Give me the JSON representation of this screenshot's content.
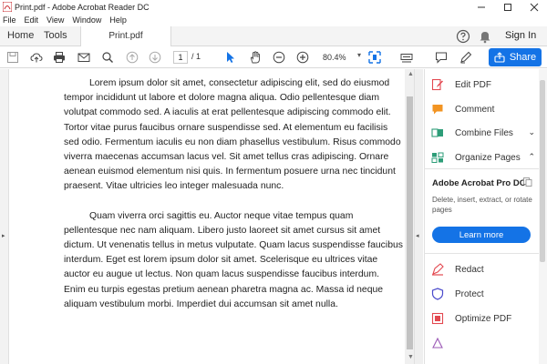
{
  "window": {
    "title": "Print.pdf - Adobe Acrobat Reader DC"
  },
  "menu": [
    "File",
    "Edit",
    "View",
    "Window",
    "Help"
  ],
  "tabs": {
    "home": "Home",
    "tools": "Tools",
    "document": "Print.pdf"
  },
  "header": {
    "signin": "Sign In"
  },
  "toolbar": {
    "page_current": "1",
    "page_total": "/ 1",
    "zoom": "80.4%",
    "share_label": "Share"
  },
  "document": {
    "paragraphs": [
      "Lorem ipsum dolor sit amet, consectetur adipiscing elit, sed do eiusmod tempor incididunt ut labore et dolore magna aliqua. Odio pellentesque diam volutpat commodo sed. A iaculis at erat pellentesque adipiscing commodo elit. Tortor vitae purus faucibus ornare suspendisse sed. At elementum eu facilisis sed odio. Fermentum iaculis eu non diam phasellus vestibulum. Risus commodo viverra maecenas accumsan lacus vel. Sit amet tellus cras adipiscing. Ornare aenean euismod elementum nisi quis. In fermentum posuere urna nec tincidunt praesent. Vitae ultricies leo integer malesuada nunc.",
      "Quam viverra orci sagittis eu. Auctor neque vitae tempus quam pellentesque nec nam aliquam. Libero justo laoreet sit amet cursus sit amet dictum. Ut venenatis tellus in metus vulputate. Quam lacus suspendisse faucibus interdum. Eget est lorem ipsum dolor sit amet. Scelerisque eu ultrices vitae auctor eu augue ut lectus. Non quam lacus suspendisse faucibus interdum. Enim eu turpis egestas pretium aenean pharetra magna ac. Massa id neque aliquam vestibulum morbi. Imperdiet dui accumsan sit amet nulla."
    ]
  },
  "right_pane": {
    "tools": [
      {
        "label": "Edit PDF",
        "icon": "edit-pdf-icon",
        "color": "#e34850"
      },
      {
        "label": "Comment",
        "icon": "comment-icon",
        "color": "#f29423"
      },
      {
        "label": "Combine Files",
        "icon": "combine-files-icon",
        "color": "#2d9d78"
      },
      {
        "label": "Organize Pages",
        "icon": "organize-pages-icon",
        "color": "#2d9d78"
      }
    ],
    "promo": {
      "title": "Adobe Acrobat Pro DC",
      "description": "Delete, insert, extract, or rotate pages",
      "button": "Learn more"
    },
    "more_tools": [
      {
        "label": "Redact",
        "icon": "redact-icon",
        "color": "#e34850"
      },
      {
        "label": "Protect",
        "icon": "protect-icon",
        "color": "#4b4bcc"
      },
      {
        "label": "Optimize PDF",
        "icon": "optimize-pdf-icon",
        "color": "#e34850"
      }
    ]
  },
  "colors": {
    "accent": "#1473e6"
  }
}
